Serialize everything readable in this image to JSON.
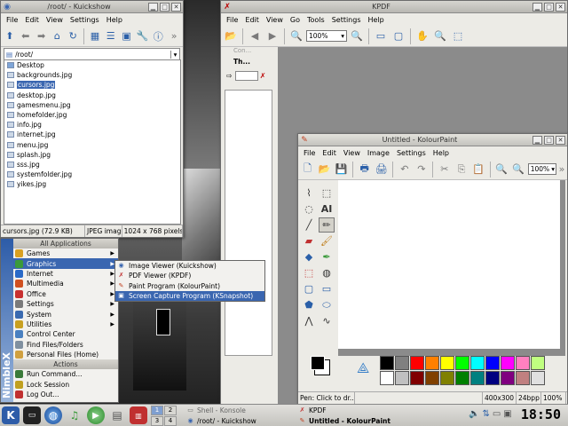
{
  "kuickshow": {
    "title": "/root/ - Kuickshow",
    "menus": [
      "File",
      "Edit",
      "View",
      "Settings",
      "Help"
    ],
    "path": "/root/",
    "files": [
      "Desktop",
      "backgrounds.jpg",
      "cursors.jpg",
      "desktop.jpg",
      "gamesmenu.jpg",
      "homefolder.jpg",
      "info.jpg",
      "internet.jpg",
      "menu.jpg",
      "splash.jpg",
      "sss.jpg",
      "systemfolder.jpg",
      "yikes.jpg"
    ],
    "selected_index": 2,
    "status": {
      "file": "cursors.jpg (72.9 KB)",
      "type": "JPEG image",
      "dims": "1024 x 768 pixels"
    }
  },
  "kpdf": {
    "title": "KPDF",
    "menus": [
      "File",
      "Edit",
      "View",
      "Go",
      "Tools",
      "Settings",
      "Help"
    ],
    "zoom": "100%",
    "thumbs_label": "Th...",
    "contents_label": "Con..."
  },
  "kolourpaint": {
    "title": "Untitled - KolourPaint",
    "menus": [
      "File",
      "Edit",
      "View",
      "Image",
      "Settings",
      "Help"
    ],
    "zoom": "100%",
    "text_tool_label": "AI",
    "status": {
      "hint": "Pen: Click to dr...",
      "size": "400x300",
      "depth": "24bpp",
      "zoom": "100%"
    },
    "palette": [
      "#000000",
      "#808080",
      "#ff0000",
      "#ff8000",
      "#ffff00",
      "#00ff00",
      "#00ffff",
      "#0000ff",
      "#ff00ff",
      "#ff80c0",
      "#c0ff80",
      "#ffffff",
      "#c0c0c0",
      "#800000",
      "#804000",
      "#808000",
      "#008000",
      "#008080",
      "#000080",
      "#800080",
      "#c08080",
      "#e0e0e0"
    ]
  },
  "kmenu": {
    "side_label": "NimbleX",
    "header_apps": "All Applications",
    "header_actions": "Actions",
    "items": [
      {
        "label": "Games",
        "sub": true,
        "color": "#d9a020"
      },
      {
        "label": "Graphics",
        "sub": true,
        "color": "#3a9a3a"
      },
      {
        "label": "Internet",
        "sub": true,
        "color": "#2a6ac8"
      },
      {
        "label": "Multimedia",
        "sub": true,
        "color": "#d05020"
      },
      {
        "label": "Office",
        "sub": true,
        "color": "#c83030"
      },
      {
        "label": "Settings",
        "sub": true,
        "color": "#7a7a7a"
      },
      {
        "label": "System",
        "sub": true,
        "color": "#3a6ab0"
      },
      {
        "label": "Utilities",
        "sub": true,
        "color": "#c8a020"
      },
      {
        "label": "Control Center",
        "sub": false,
        "color": "#4a80c0"
      },
      {
        "label": "Find Files/Folders",
        "sub": false,
        "color": "#8090a0"
      },
      {
        "label": "Personal Files (Home)",
        "sub": false,
        "color": "#d0a040"
      }
    ],
    "actions": [
      {
        "label": "Run Command...",
        "color": "#3a7a3a"
      },
      {
        "label": "Lock Session",
        "color": "#c0a020"
      },
      {
        "label": "Log Out...",
        "color": "#c03030"
      }
    ]
  },
  "submenu": {
    "items": [
      "Image Viewer (Kuickshow)",
      "PDF Viewer (KPDF)",
      "Paint Program (KolourPaint)",
      "Screen Capture Program (KSnapshot)"
    ]
  },
  "taskbar": {
    "pager": [
      "1",
      "2",
      "3",
      "4"
    ],
    "tasks": [
      "Shell - Konsole",
      "/root/ - Kuickshow",
      "KPDF",
      "Untitled - KolourPaint"
    ],
    "clock": "18:50"
  }
}
